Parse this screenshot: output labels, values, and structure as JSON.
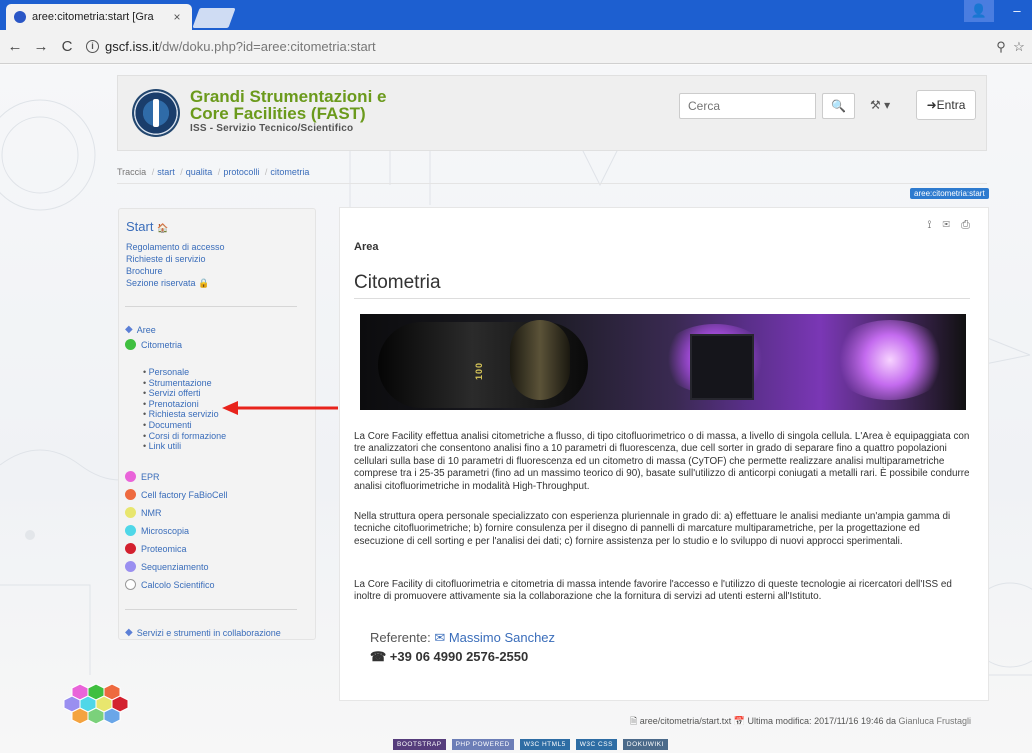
{
  "browser": {
    "tab_title": "aree:citometria:start [Gra",
    "tab_close": "×",
    "url_host": "gscf.iss.it",
    "url_path": "/dw/doku.php?id=aree:citometria:start",
    "back": "←",
    "forward": "→",
    "reload": "C",
    "minimize": "–"
  },
  "header": {
    "title_line1": "Grandi Strumentazioni e",
    "title_line2": "Core Facilities (FAST)",
    "subtitle": "ISS - Servizio Tecnico/Scientifico",
    "search_placeholder": "Cerca",
    "search_icon": "🔍",
    "tools_label": "⚒ ▾",
    "login_label": "➜Entra"
  },
  "breadcrumb": {
    "label": "Traccia",
    "items": [
      "start",
      "qualita",
      "protocolli",
      "citometria"
    ]
  },
  "page_id_badge": "aree:citometria:start",
  "sidebar": {
    "start_label": "Start",
    "home_icon": "🏠",
    "links": [
      "Regolamento di accesso",
      "Richieste di servizio",
      "Brochure",
      "Sezione riservata 🔒"
    ],
    "aree_label": "Aree",
    "citometria_label": "Citometria",
    "sub_items": [
      "Personale",
      "Strumentazione",
      "Servizi offerti",
      "Prenotazioni",
      "Richiesta servizio",
      "Documenti",
      "Corsi di formazione",
      "Link utili"
    ],
    "areas": [
      {
        "label": "EPR",
        "color": "#e964d9"
      },
      {
        "label": "Cell factory FaBioCell",
        "color": "#ee6a3f"
      },
      {
        "label": "NMR",
        "color": "#e8e66e"
      },
      {
        "label": "Microscopia",
        "color": "#4fd7e8"
      },
      {
        "label": "Proteomica",
        "color": "#d3202e"
      },
      {
        "label": "Sequenziamento",
        "color": "#9a8ff0"
      },
      {
        "label": "Calcolo Scientifico",
        "color": "#ffffff"
      }
    ],
    "collab_label": "Servizi e strumenti in collaborazione"
  },
  "content": {
    "tool_icons": "⟟ ✉ ⎙",
    "area_label": "Area",
    "title": "Citometria",
    "hero_label": "100",
    "para1": "La Core Facility effettua analisi citometriche a flusso, di tipo citofluorimetrico o di massa, a livello di singola cellula. L'Area è equipaggiata con tre analizzatori che consentono analisi fino a 10 parametri di fluorescenza, due cell sorter in grado di separare fino a quattro popolazioni cellulari sulla base di 10 parametri di fluorescenza ed un citometro di massa (CyTOF) che permette realizzare analisi multiparametriche comprese tra i 25-35 parametri (fino ad un massimo teorico di 90), basate sull'utilizzo di anticorpi coniugati a metalli rari. È possibile condurre analisi citofluorimetriche in modalità High-Throughput.",
    "para2": "Nella struttura opera personale specializzato con esperienza pluriennale in grado di: a) effettuare le analisi mediante un'ampia gamma di tecniche citofluorimetriche; b) fornire consulenza per il disegno di pannelli di marcature multiparametriche, per la progettazione ed esecuzione di cell sorting e per l'analisi dei dati; c) fornire assistenza per lo studio e lo sviluppo di nuovi approcci sperimentali.",
    "para3": "La Core Facility di citofluorimetria e citometria di massa intende favorire l'accesso e l'utilizzo di queste tecnologie ai ricercatori dell'ISS ed inoltre di promuovere attivamente sia la collaborazione che la fornitura di servizi ad utenti esterni all'Istituto.",
    "referente_label": "Referente:",
    "referente_name": "✉ Massimo Sanchez",
    "phone": "☎ +39 06 4990 2576-2550"
  },
  "footer": {
    "file": "aree/citometria/start.txt",
    "modified": "Ultima modifica: 2017/11/16 19:46",
    "by": "da",
    "user": "Gianluca Frustagli",
    "badges": [
      "BOOTSTRAP",
      "PHP POWERED",
      "W3C HTML5",
      "W3C CSS",
      "DOKUWIKI"
    ]
  }
}
